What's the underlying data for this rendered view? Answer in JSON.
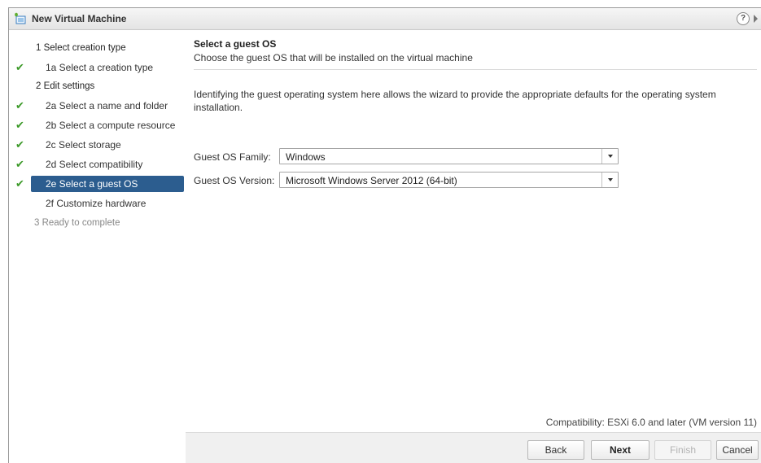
{
  "window": {
    "title": "New Virtual Machine",
    "help_glyph": "?"
  },
  "steps": [
    {
      "id": "1",
      "label": "1  Select creation type",
      "kind": "head",
      "checked": false,
      "state": "normal"
    },
    {
      "id": "1a",
      "label": "1a  Select a creation type",
      "kind": "sub",
      "checked": true,
      "state": "normal"
    },
    {
      "id": "2",
      "label": "2  Edit settings",
      "kind": "head",
      "checked": false,
      "state": "normal"
    },
    {
      "id": "2a",
      "label": "2a  Select a name and folder",
      "kind": "sub",
      "checked": true,
      "state": "normal"
    },
    {
      "id": "2b",
      "label": "2b  Select a compute resource",
      "kind": "sub",
      "checked": true,
      "state": "normal"
    },
    {
      "id": "2c",
      "label": "2c  Select storage",
      "kind": "sub",
      "checked": true,
      "state": "normal"
    },
    {
      "id": "2d",
      "label": "2d  Select compatibility",
      "kind": "sub",
      "checked": true,
      "state": "normal"
    },
    {
      "id": "2e",
      "label": "2e  Select a guest OS",
      "kind": "sub",
      "checked": true,
      "state": "selected"
    },
    {
      "id": "2f",
      "label": "2f  Customize hardware",
      "kind": "sub",
      "checked": false,
      "state": "normal"
    },
    {
      "id": "3",
      "label": "3  Ready to complete",
      "kind": "head",
      "checked": false,
      "state": "disabled"
    }
  ],
  "content": {
    "title": "Select a guest OS",
    "subtitle": "Choose the guest OS that will be installed on the virtual machine",
    "description": "Identifying the guest operating system here allows the wizard to provide the appropriate defaults for the operating system installation.",
    "family_label": "Guest OS Family:",
    "family_value": "Windows",
    "version_label": "Guest OS Version:",
    "version_value": "Microsoft Windows Server 2012 (64-bit)",
    "compatibility": "Compatibility: ESXi 6.0 and later (VM version 11)"
  },
  "footer": {
    "back": "Back",
    "next": "Next",
    "finish": "Finish",
    "cancel": "Cancel"
  },
  "colors": {
    "selected": "#2c5d8f",
    "check": "#3d9a2a"
  }
}
